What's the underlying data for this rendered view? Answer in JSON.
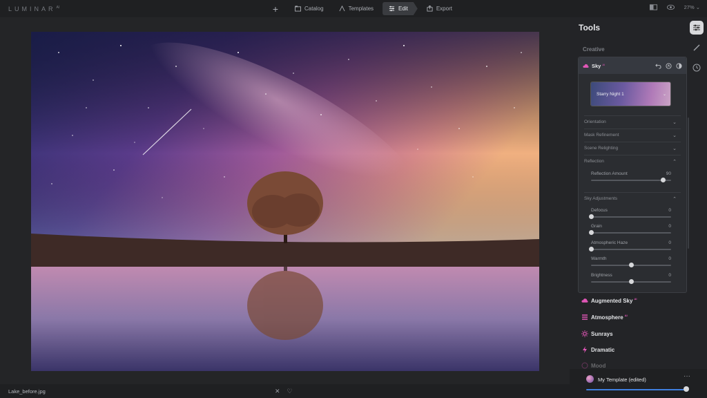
{
  "app": {
    "logo": "LUMINAR",
    "logo_version": "AI"
  },
  "nav": {
    "items": [
      {
        "label": "Catalog",
        "icon": "catalog-icon"
      },
      {
        "label": "Templates",
        "icon": "templates-icon"
      },
      {
        "label": "Edit",
        "icon": "edit-sliders-icon",
        "active": true
      },
      {
        "label": "Export",
        "icon": "export-icon"
      }
    ]
  },
  "top_right": {
    "zoom": "27%"
  },
  "photo": {
    "filename": "Lake_before.jpg"
  },
  "panel": {
    "title": "Tools",
    "section": "Creative",
    "sky": {
      "name": "Sky",
      "badge": "AI",
      "preset": "Starry Night 1",
      "collapsed_sections": [
        "Orientation",
        "Mask Refinement",
        "Scene Relighting"
      ],
      "reflection": {
        "label": "Reflection",
        "slider": {
          "label": "Reflection Amount",
          "value": "90",
          "fraction": 0.9
        }
      },
      "adjustments": {
        "label": "Sky Adjustments",
        "sliders": [
          {
            "label": "Defocus",
            "value": "0",
            "fraction": 0.0
          },
          {
            "label": "Grain",
            "value": "0",
            "fraction": 0.0
          },
          {
            "label": "Atmospheric Haze",
            "value": "0",
            "fraction": 0.0
          },
          {
            "label": "Warmth",
            "value": "0",
            "fraction": 0.5
          },
          {
            "label": "Brightness",
            "value": "0",
            "fraction": 0.5
          }
        ]
      }
    },
    "tools": [
      {
        "label": "Augmented Sky",
        "badge": "AI",
        "icon": "cloud-icon"
      },
      {
        "label": "Atmosphere",
        "badge": "AI",
        "icon": "atmosphere-icon"
      },
      {
        "label": "Sunrays",
        "badge": "",
        "icon": "sun-icon"
      },
      {
        "label": "Dramatic",
        "badge": "",
        "icon": "lightning-icon"
      },
      {
        "label": "Mood",
        "badge": "",
        "icon": "mood-icon"
      }
    ],
    "template": {
      "name": "My Template (edited)",
      "amount": 1.0
    }
  },
  "colors": {
    "accent": "#e056b6",
    "slider_blue": "#3f7fe0"
  }
}
